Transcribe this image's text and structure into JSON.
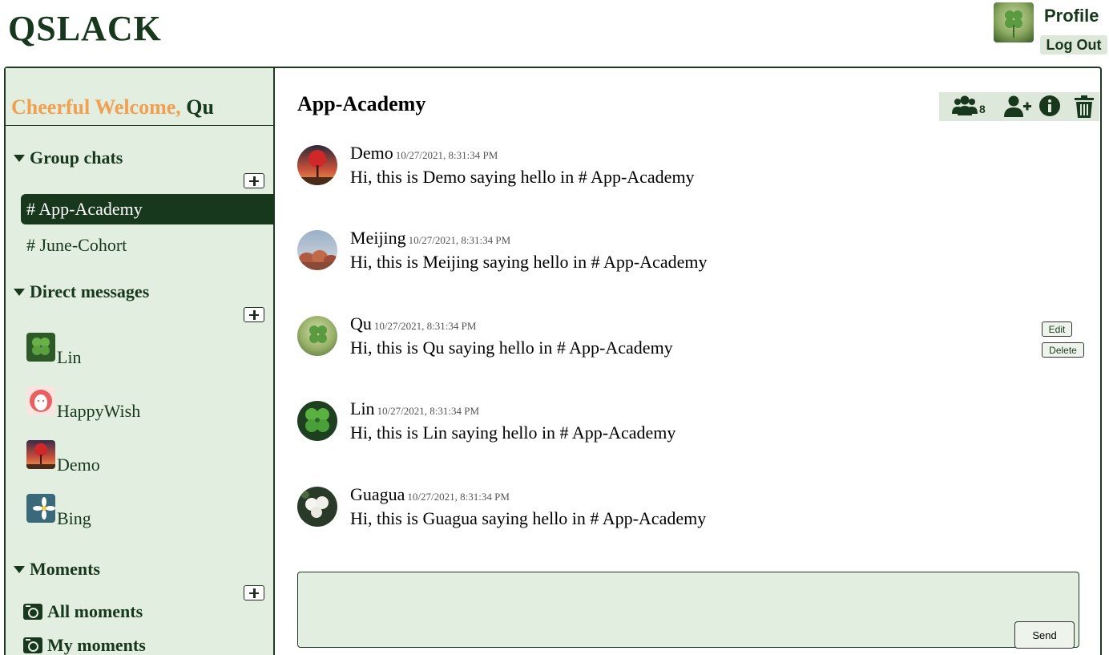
{
  "app": {
    "title": "QSLACK"
  },
  "header": {
    "profile_label": "Profile",
    "logout_label": "Log Out"
  },
  "sidebar": {
    "welcome_label": "Cheerful Welcome,",
    "welcome_user": "Qu",
    "group_chats": {
      "header": "Group chats",
      "items": [
        {
          "label": "# App-Academy",
          "active": true
        },
        {
          "label": "# June-Cohort",
          "active": false
        }
      ]
    },
    "direct_messages": {
      "header": "Direct messages",
      "items": [
        {
          "name": "Lin"
        },
        {
          "name": "HappyWish"
        },
        {
          "name": "Demo"
        },
        {
          "name": "Bing"
        }
      ]
    },
    "moments": {
      "header": "Moments",
      "items": [
        {
          "label": "All moments"
        },
        {
          "label": "My moments"
        }
      ]
    }
  },
  "channel": {
    "title": "App-Academy",
    "member_count": "8",
    "toolbar_icons": [
      "members-icon",
      "add-member-icon",
      "info-icon",
      "trash-icon"
    ]
  },
  "messages": [
    {
      "author": "Demo",
      "time": "10/27/2021, 8:31:34 PM",
      "text": "Hi, this is Demo saying hello in # App-Academy"
    },
    {
      "author": "Meijing",
      "time": "10/27/2021, 8:31:34 PM",
      "text": "Hi, this is Meijing saying hello in # App-Academy"
    },
    {
      "author": "Qu",
      "time": "10/27/2021, 8:31:34 PM",
      "text": "Hi, this is Qu saying hello in # App-Academy",
      "edit_label": "Edit",
      "delete_label": "Delete"
    },
    {
      "author": "Lin",
      "time": "10/27/2021, 8:31:34 PM",
      "text": "Hi, this is Lin saying hello in # App-Academy"
    },
    {
      "author": "Guagua",
      "time": "10/27/2021, 8:31:34 PM",
      "text": "Hi, this is Guagua saying hello in # App-Academy"
    }
  ],
  "composer": {
    "send_label": "Send"
  },
  "colors": {
    "primary_dark": "#17381d",
    "sidebar_bg": "#e2eedf",
    "welcome_accent": "#f0a050",
    "active_channel_bg": "#17381d"
  }
}
